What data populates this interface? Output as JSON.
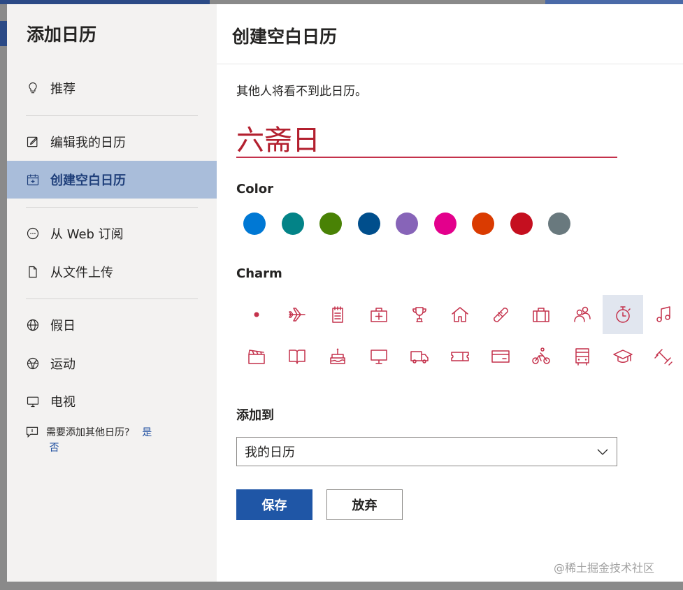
{
  "sidebar": {
    "title": "添加日历",
    "items": [
      {
        "label": "推荐",
        "icon": "lightbulb-icon"
      },
      {
        "label": "编辑我的日历",
        "icon": "edit-calendar-icon"
      },
      {
        "label": "创建空白日历",
        "icon": "calendar-add-icon",
        "active": true
      },
      {
        "label": "从 Web 订阅",
        "icon": "web-subscribe-icon"
      },
      {
        "label": "从文件上传",
        "icon": "file-upload-icon"
      },
      {
        "label": "假日",
        "icon": "globe-icon"
      },
      {
        "label": "运动",
        "icon": "sports-ball-icon"
      },
      {
        "label": "电视",
        "icon": "tv-icon"
      }
    ],
    "need_more": {
      "text": "需要添加其他日历?",
      "yes": "是",
      "no": "否"
    }
  },
  "main": {
    "title": "创建空白日历",
    "subtitle": "其他人将看不到此日历。",
    "calendar_name": "六斋日",
    "color_label": "Color",
    "colors": [
      "#0078d4",
      "#038387",
      "#498205",
      "#004e8c",
      "#8764b8",
      "#e3008c",
      "#da3b01",
      "#c50f1f",
      "#69797e"
    ],
    "charm_label": "Charm",
    "charm_color": "#c4314b",
    "charms_row1": [
      "dot-icon",
      "airplane-icon",
      "notepad-icon",
      "medical-kit-icon",
      "trophy-icon",
      "home-icon",
      "bandage-icon",
      "briefcase-icon",
      "people-icon",
      "stopwatch-icon",
      "music-note-icon"
    ],
    "charms_row2": [
      "clapperboard-icon",
      "book-icon",
      "birthday-cake-icon",
      "monitor-icon",
      "truck-icon",
      "ticket-icon",
      "credit-card-icon",
      "cyclist-icon",
      "bus-icon",
      "graduation-cap-icon",
      "dumbbell-icon"
    ],
    "selected_charm": "stopwatch-icon",
    "add_to_label": "添加到",
    "add_to_value": "我的日历",
    "save_label": "保存",
    "discard_label": "放弃"
  },
  "watermark": "@稀土掘金技术社区"
}
